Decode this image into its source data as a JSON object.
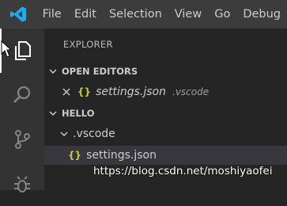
{
  "menu": [
    "File",
    "Edit",
    "Selection",
    "View",
    "Go",
    "Debug"
  ],
  "sidebar": {
    "title": "EXPLORER",
    "open_editors": {
      "label": "OPEN EDITORS",
      "items": [
        {
          "name": "settings.json",
          "folder": ".vscode"
        }
      ]
    },
    "workspace": {
      "label": "HELLO",
      "folder": ".vscode",
      "file": "settings.json"
    }
  },
  "icons": {
    "logo": "vscode-logo-icon",
    "activity": [
      "files-icon",
      "search-icon",
      "source-control-icon",
      "debug-icon"
    ],
    "close": "close-icon",
    "json": "json-icon",
    "json_glyph": "{}"
  },
  "watermark": "https://blog.csdn.net/moshiyaofei",
  "colors": {
    "titlebar": "#3c3c3c",
    "activitybar": "#333333",
    "sidebar": "#252526",
    "selection": "#37373d",
    "logo": "#23a9f2",
    "json": "#cbcb41"
  }
}
